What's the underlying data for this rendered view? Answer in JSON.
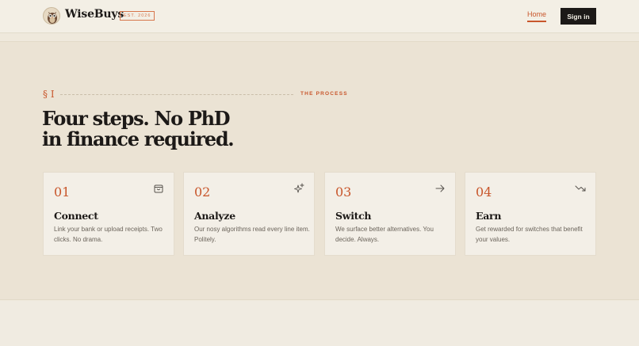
{
  "brand": {
    "name": "WiseBuys",
    "badge": "EST. 2026"
  },
  "nav": {
    "home": "Home",
    "signin": "Sign in"
  },
  "section": {
    "number": "§ I",
    "label": "THE PROCESS",
    "headline_line1": "Four steps. No PhD",
    "headline_line2": "in finance required."
  },
  "steps": [
    {
      "num": "01",
      "title": "Connect",
      "desc": "Link your bank or upload receipts. Two clicks. No drama.",
      "icon": "shopping-bag-icon"
    },
    {
      "num": "02",
      "title": "Analyze",
      "desc": "Our nosy algorithms read every line item. Politely.",
      "icon": "sparkles-icon"
    },
    {
      "num": "03",
      "title": "Switch",
      "desc": "We surface better alternatives. You decide. Always.",
      "icon": "arrow-right-icon"
    },
    {
      "num": "04",
      "title": "Earn",
      "desc": "Get rewarded for switches that benefit your values.",
      "icon": "trending-down-icon"
    }
  ],
  "colors": {
    "accent": "#c8562b",
    "dark": "#1c1917",
    "background": "#ebe3d4",
    "card": "#f3efe7"
  }
}
